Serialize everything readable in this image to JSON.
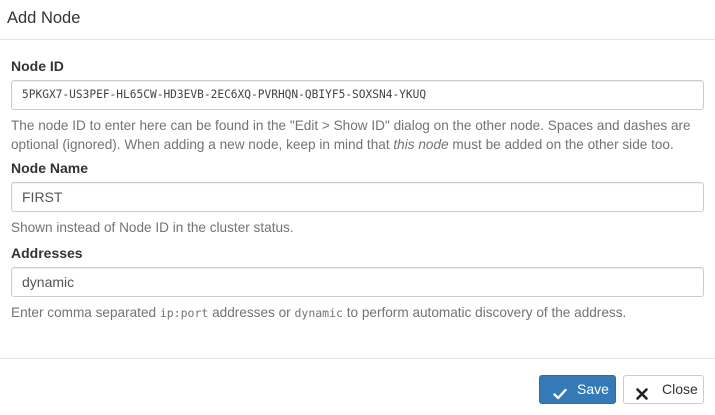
{
  "dialog": {
    "title": "Add Node"
  },
  "node_id": {
    "label": "Node ID",
    "value": "5PKGX7-US3PEF-HL65CW-HD3EVB-2EC6XQ-PVRHQN-QBIYF5-SOXSN4-YKUQ",
    "help_part1": "The node ID to enter here can be found in the \"Edit > Show ID\" dialog on the other node. Spaces and dashes are optional (ignored). When adding a new node, keep in mind that ",
    "help_em": "this node",
    "help_part2": " must be added on the other side too."
  },
  "node_name": {
    "label": "Node Name",
    "value": "FIRST",
    "help": "Shown instead of Node ID in the cluster status."
  },
  "addresses": {
    "label": "Addresses",
    "value": "dynamic",
    "help_part1": "Enter comma separated ",
    "help_code1": "ip:port",
    "help_part2": " addresses or ",
    "help_code2": "dynamic",
    "help_part3": " to perform automatic discovery of the address."
  },
  "footer": {
    "save_label": "Save",
    "save_icon": "check-icon",
    "close_label": "Close",
    "close_icon": "close-icon",
    "save_color": "#337ab7"
  }
}
